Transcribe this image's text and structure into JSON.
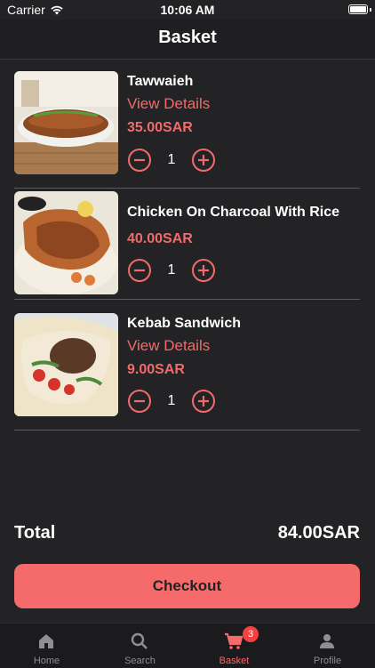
{
  "status": {
    "carrier": "Carrier",
    "time": "10:06 AM"
  },
  "nav": {
    "title": "Basket"
  },
  "colors": {
    "accent": "#f56b6b",
    "background": "#232325"
  },
  "items": [
    {
      "name": "Tawwaieh",
      "details": "View Details",
      "price": "35.00SAR",
      "qty": "1"
    },
    {
      "name": "Chicken On Charcoal With Rice",
      "price": "40.00SAR",
      "qty": "1"
    },
    {
      "name": "Kebab Sandwich",
      "details": "View Details",
      "price": "9.00SAR",
      "qty": "1"
    }
  ],
  "summary": {
    "total_label": "Total",
    "total_value": "84.00SAR"
  },
  "checkout_label": "Checkout",
  "tabs": [
    {
      "label": "Home",
      "icon": "home-icon"
    },
    {
      "label": "Search",
      "icon": "search-icon"
    },
    {
      "label": "Basket",
      "icon": "cart-icon",
      "badge": "3",
      "active": true
    },
    {
      "label": "Profile",
      "icon": "person-icon"
    }
  ]
}
